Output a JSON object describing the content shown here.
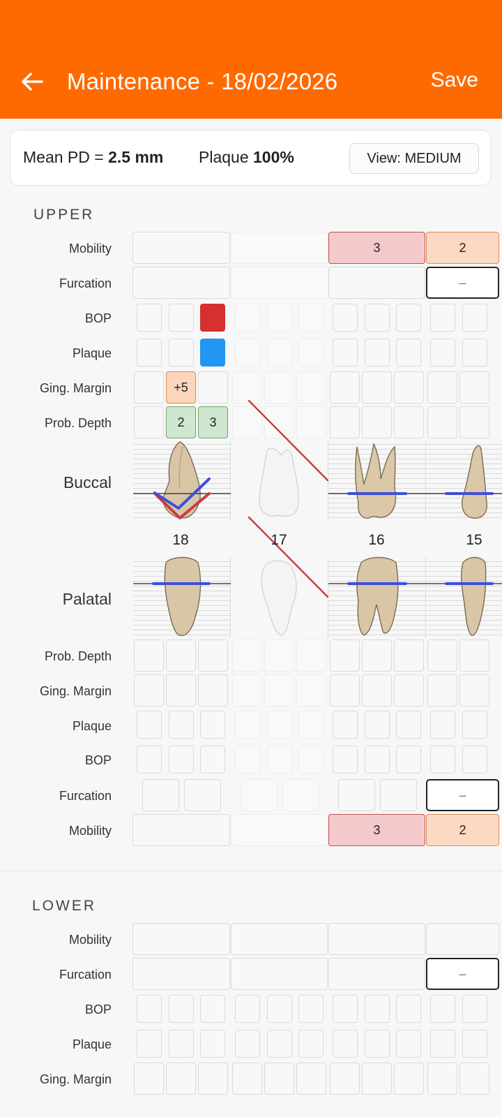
{
  "appbar": {
    "title": "Maintenance - 18/02/2026",
    "save_label": "Save"
  },
  "summary": {
    "mean_pd_label": "Mean PD =",
    "mean_pd_value": "2.5 mm",
    "plaque_label": "Plaque",
    "plaque_value": "100%",
    "view_label": "View: MEDIUM"
  },
  "upper": {
    "section_label": "UPPER",
    "rows": {
      "mobility": "Mobility",
      "furcation": "Furcation",
      "bop": "BOP",
      "plaque": "Plaque",
      "ging_margin": "Ging. Margin",
      "prob_depth": "Prob. Depth"
    },
    "buccal_label": "Buccal",
    "palatal_label": "Palatal",
    "teeth": [
      "18",
      "17",
      "16",
      "15"
    ],
    "values": {
      "t18_ging_margin_mid": "+5",
      "t18_prob_depth_mid": "2",
      "t18_prob_depth_dist": "3",
      "t16_mobility": "3",
      "t15_mobility": "2",
      "t15_furcation": "–",
      "t16_mobility_palatal": "3",
      "t15_mobility_palatal": "2",
      "t15_furcation_palatal": "–"
    }
  },
  "lower": {
    "section_label": "LOWER",
    "rows": {
      "mobility": "Mobility",
      "furcation": "Furcation",
      "bop": "BOP",
      "plaque": "Plaque",
      "ging_margin": "Ging. Margin"
    },
    "values": {
      "t15_furcation": "–"
    }
  },
  "colors": {
    "accent": "#ff6a00",
    "bop": "#d6302f",
    "plaque": "#2196f3",
    "mobility_3": "#f3c9cb",
    "mobility_2": "#fbd9c3",
    "gingival_line": "#3d4fd9",
    "missing_tooth": "#c83b3b"
  },
  "icons": {
    "back": "arrow-left-icon"
  }
}
